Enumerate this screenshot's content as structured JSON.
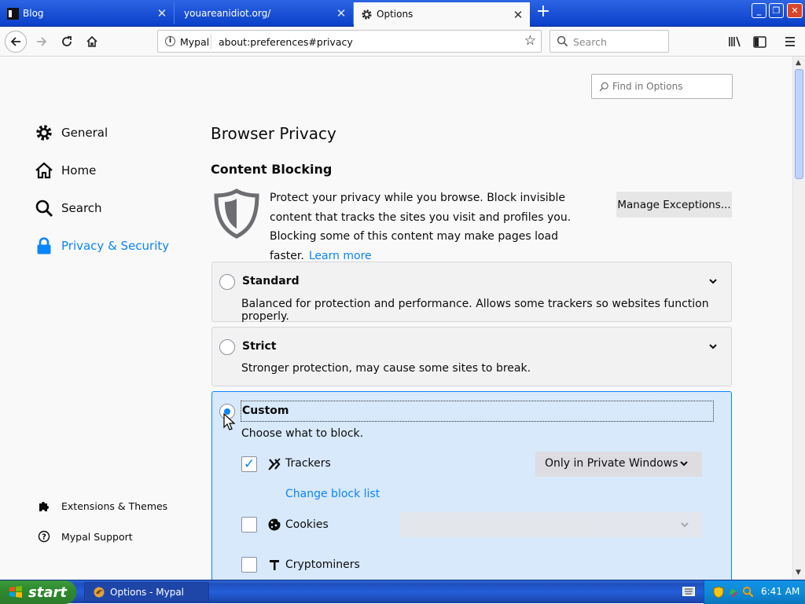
{
  "tabs": [
    {
      "label": "Blog",
      "selected": false
    },
    {
      "label": "youareanidiot.org/",
      "selected": false
    },
    {
      "label": "Options",
      "selected": true
    }
  ],
  "urlbar": {
    "identity": "Mypal",
    "url": "about:preferences#privacy"
  },
  "searchbar": {
    "placeholder": "Search"
  },
  "find": {
    "placeholder": "Find in Options"
  },
  "categories": [
    {
      "label": "General",
      "icon": "gear-icon"
    },
    {
      "label": "Home",
      "icon": "home-icon"
    },
    {
      "label": "Search",
      "icon": "search-icon"
    },
    {
      "label": "Privacy & Security",
      "icon": "lock-icon",
      "selected": true
    }
  ],
  "footer_links": [
    {
      "label": "Extensions & Themes",
      "icon": "puzzle-icon"
    },
    {
      "label": "Mypal Support",
      "icon": "help-icon"
    }
  ],
  "main": {
    "title": "Browser Privacy",
    "blocking_heading": "Content Blocking",
    "blocking_desc": "Protect your privacy while you browse. Block invisible content that tracks the sites you visit and profiles you. Blocking some of this content may make pages load faster.",
    "learn_more": "Learn more",
    "manage_button": "Manage Exceptions...",
    "options": [
      {
        "title": "Standard",
        "desc": "Balanced for protection and performance. Allows some trackers so websites function properly.",
        "selected": false
      },
      {
        "title": "Strict",
        "desc": "Stronger protection, may cause some sites to break.",
        "selected": false
      },
      {
        "title": "Custom",
        "desc": "Choose what to block.",
        "selected": true
      }
    ],
    "custom": {
      "trackers": {
        "label": "Trackers",
        "checked": true,
        "select_value": "Only in Private Windows",
        "link": "Change block list"
      },
      "cookies": {
        "label": "Cookies",
        "checked": false
      },
      "cryptominers": {
        "label": "Cryptominers",
        "checked": false
      }
    }
  },
  "taskbar": {
    "start": "start",
    "item": "Options - Mypal",
    "time": "6:41 AM"
  },
  "colors": {
    "accent": "#0a84ff",
    "xp_blue": "#245edb",
    "start_green": "#2f8a2f"
  }
}
